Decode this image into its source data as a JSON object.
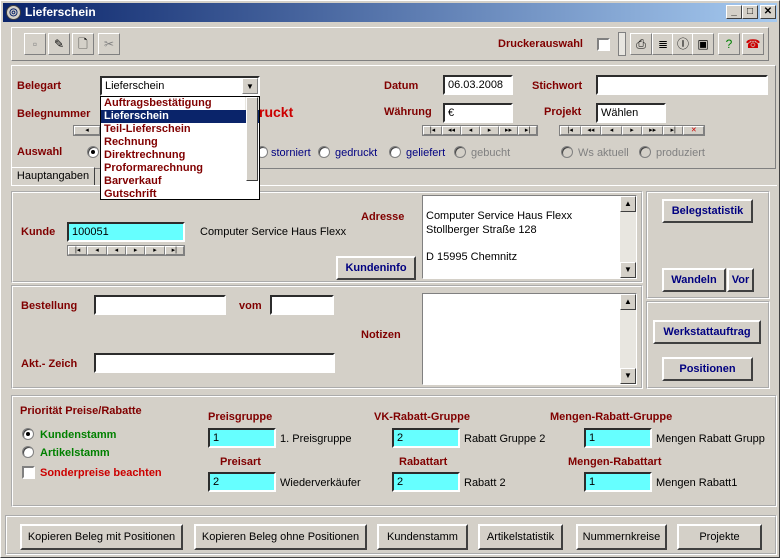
{
  "window": {
    "title": "Lieferschein",
    "min": "_",
    "max": "□",
    "close": "✕"
  },
  "toolbar": {
    "druckerauswahl": "Druckerauswahl"
  },
  "belegart": {
    "label": "Belegart",
    "value": "Lieferschein",
    "options": [
      "Auftragsbestätigung",
      "Lieferschein",
      "Teil-Lieferschein",
      "Rechnung",
      "Direktrechnung",
      "Proformarechnung",
      "Barverkauf",
      "Gutschrift"
    ]
  },
  "belegnummer": {
    "label": "Belegnummer",
    "partial": "ruckt"
  },
  "datum": {
    "label": "Datum",
    "value": "06.03.2008"
  },
  "stichwort": {
    "label": "Stichwort",
    "value": ""
  },
  "waehrung": {
    "label": "Währung",
    "value": "€"
  },
  "projekt": {
    "label": "Projekt",
    "value": "Wählen"
  },
  "auswahl": {
    "label": "Auswahl",
    "options": [
      "storniert",
      "gedruckt",
      "geliefert",
      "gebucht",
      "Ws aktuell",
      "produziert"
    ]
  },
  "tabs": {
    "hauptangaben": "Hauptangaben"
  },
  "kunde": {
    "label": "Kunde",
    "value": "100051",
    "name": "Computer Service Haus Flexx"
  },
  "adresse": {
    "label": "Adresse",
    "lines": [
      "Computer Service Haus Flexx",
      "Stollberger Straße 128",
      "",
      "D 15995 Chemnitz"
    ]
  },
  "buttons": {
    "kundeninfo": "Kundeninfo",
    "belegstatistik": "Belegstatistik",
    "wandeln": "Wandeln",
    "vor": "Vor",
    "werkstattauftrag": "Werkstattauftrag",
    "positionen": "Positionen"
  },
  "bestellung": {
    "label": "Bestellung",
    "value": "",
    "vom_label": "vom",
    "vom_value": ""
  },
  "aktzeich": {
    "label": "Akt.- Zeich",
    "value": ""
  },
  "notizen": {
    "label": "Notizen"
  },
  "prioritaet": {
    "label": "Priorität Preise/Rabatte",
    "kundenstamm": "Kundenstamm",
    "artikelstamm": "Artikelstamm",
    "sonderpreise": "Sonderpreise beachten"
  },
  "preisgruppe": {
    "label": "Preisgruppe",
    "value": "1",
    "desc": "1. Preisgruppe"
  },
  "vkrabatt": {
    "label": "VK-Rabatt-Gruppe",
    "value": "2",
    "desc": "Rabatt Gruppe 2"
  },
  "mengenrabattgruppe": {
    "label": "Mengen-Rabatt-Gruppe",
    "value": "1",
    "desc": "Mengen Rabatt Grupp"
  },
  "preisart": {
    "label": "Preisart",
    "value": "2",
    "desc": "Wiederverkäufer"
  },
  "rabattart": {
    "label": "Rabattart",
    "value": "2",
    "desc": "Rabatt 2"
  },
  "mengenrabattart": {
    "label": "Mengen-Rabattart",
    "value": "1",
    "desc": "Mengen Rabatt1"
  },
  "bottom": {
    "kopieren_mit": "Kopieren Beleg mit Positionen",
    "kopieren_ohne": "Kopieren Beleg ohne Positionen",
    "kundenstamm": "Kundenstamm",
    "artikelstatistik": "Artikelstatistik",
    "nummernkreise": "Nummernkreise",
    "projekte": "Projekte"
  },
  "colors": {
    "titlebar": "#0a246a",
    "label": "#800000",
    "button_text": "#000080",
    "highlight": "#66ffff"
  }
}
